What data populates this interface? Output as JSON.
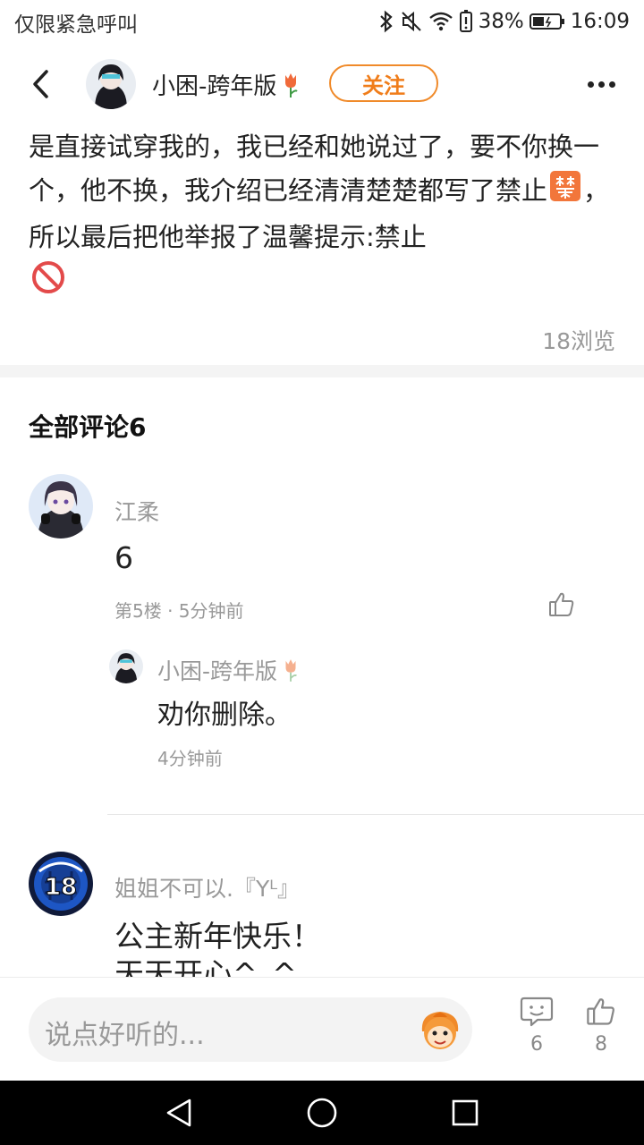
{
  "status_bar": {
    "carrier": "仅限紧急呼叫",
    "battery": "38%",
    "time": "16:09"
  },
  "header": {
    "author_name": "小困-跨年版",
    "follow_label": "关注"
  },
  "post": {
    "text_part1": "是直接试穿我的，我已经和她说过了，要不你换一个，他不换，我介绍已经清清楚楚都写了禁止",
    "text_part2": "，所以最后把他举报了温馨提示:禁止",
    "views": "18浏览"
  },
  "comments_title": "全部评论6",
  "comments": [
    {
      "name": "江柔",
      "text": "6",
      "meta": "第5楼 · 5分钟前"
    },
    {
      "name": "姐姐不可以.『Yᴸ』",
      "text_line1": "公主新年快乐！",
      "text_line2": "天天开心^_^"
    }
  ],
  "reply": {
    "name": "小困-跨年版",
    "text": "劝你删除。",
    "time": "4分钟前"
  },
  "bottom_bar": {
    "input_placeholder": "说点好听的...",
    "comment_count": "6",
    "like_count": "8"
  },
  "colors": {
    "accent": "#f07d1a",
    "muted": "#999999"
  }
}
